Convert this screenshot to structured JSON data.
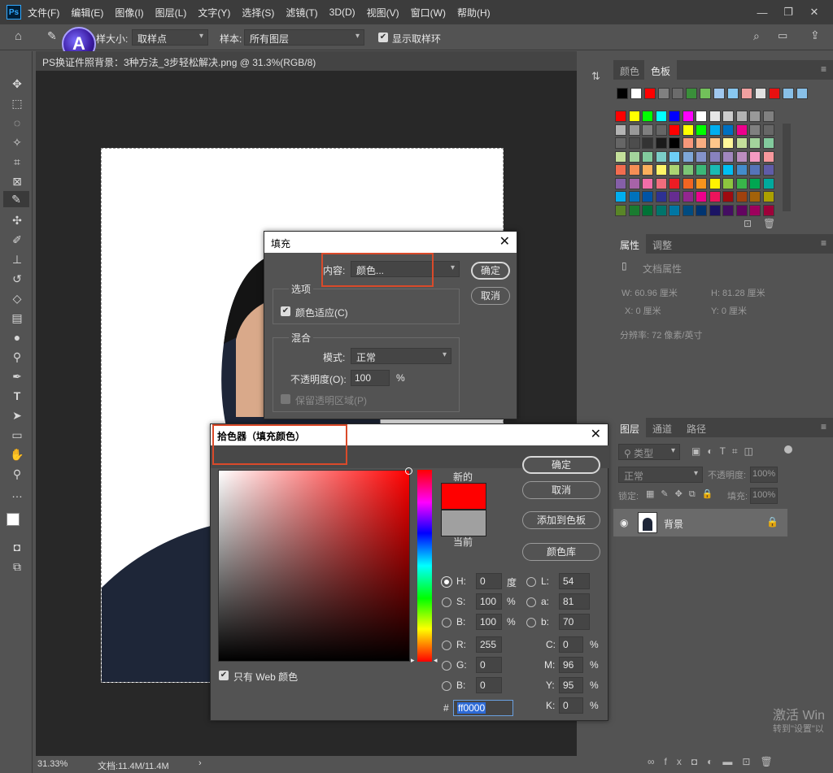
{
  "app": {
    "logo": "Ps"
  },
  "menu": [
    "文件(F)",
    "编辑(E)",
    "图像(I)",
    "图层(L)",
    "文字(Y)",
    "选择(S)",
    "滤镜(T)",
    "3D(D)",
    "视图(V)",
    "窗口(W)",
    "帮助(H)"
  ],
  "options": {
    "sample_size_label": "样大小:",
    "sample_size_value": "取样点",
    "sample_label": "样本:",
    "sample_value": "所有图层",
    "show_ring": "显示取样环"
  },
  "document": {
    "tab_title": "PS换证件照背景：3种方法_3步轻松解决.png @ 31.3%(RGB/8)",
    "tab_close": "×",
    "zoom": "31.33%",
    "doc_size": "文档:11.4M/11.4M"
  },
  "swatches_panel": {
    "tabs": [
      "颜色",
      "色板"
    ],
    "recent": [
      "#000000",
      "#ffffff",
      "#ff0000",
      "#808080",
      "#6b6b6b",
      "#3a8f3a",
      "#72c05a",
      "#a0c8ee",
      "#88c8f0",
      "#f0a0a0",
      "#e0e0e0",
      "#e81010",
      "#88c0e8",
      "#88c0e8"
    ],
    "grid": [
      [
        "#ff0000",
        "#ffff00",
        "#00ff00",
        "#00ffff",
        "#0000ff",
        "#ff00ff",
        "#ffffff",
        "#e6e6e6",
        "#cccccc",
        "#b3b3b3",
        "#999999",
        "#808080"
      ],
      [
        "#b3b3b3",
        "#999999",
        "#808080",
        "#666666",
        "#ff0000",
        "#ffff00",
        "#00ff00",
        "#00aeef",
        "#0070c0",
        "#ec008c",
        "#808080",
        "#666666"
      ],
      [
        "#666666",
        "#4d4d4d",
        "#333333",
        "#1a1a1a",
        "#000000",
        "#f7977a",
        "#f9ad81",
        "#fdc68a",
        "#fff79a",
        "#c4df9b",
        "#a3d39c",
        "#82ca9d"
      ],
      [
        "#c4df9b",
        "#a3d39c",
        "#82ca9d",
        "#7bcdc8",
        "#6ecff6",
        "#7ea7d8",
        "#8493ca",
        "#8882be",
        "#a187be",
        "#bc8dbf",
        "#f49ac2",
        "#f6989d"
      ],
      [
        "#f26c4f",
        "#f68e55",
        "#fbaf5c",
        "#fff467",
        "#acd372",
        "#7cc576",
        "#3bb878",
        "#1abbb4",
        "#00bff3",
        "#438ccb",
        "#5574b9",
        "#605ca8"
      ],
      [
        "#855fa8",
        "#a763a8",
        "#f06ea9",
        "#f26d7d",
        "#ed1c24",
        "#f26522",
        "#f7941d",
        "#fff200",
        "#8dc63f",
        "#39b54a",
        "#00a651",
        "#00a99d"
      ],
      [
        "#00aeef",
        "#0072bc",
        "#0054a6",
        "#2e3192",
        "#662d91",
        "#92278f",
        "#ec008c",
        "#ed145b",
        "#9e0b0f",
        "#a0410d",
        "#a36209",
        "#aba000"
      ],
      [
        "#598527",
        "#1a7b30",
        "#007236",
        "#00746b",
        "#0076a3",
        "#004b80",
        "#003471",
        "#1b1464",
        "#440e62",
        "#630460",
        "#9e005d",
        "#9e0039"
      ]
    ]
  },
  "properties_panel": {
    "tabs": [
      "属性",
      "调整"
    ],
    "doc_props": "文档属性",
    "w": "W: 60.96 厘米",
    "h": "H: 81.28 厘米",
    "x": "X: 0 厘米",
    "y": "Y: 0 厘米",
    "resolution": "分辨率: 72 像素/英寸"
  },
  "layers_panel": {
    "tabs": [
      "图层",
      "通道",
      "路径"
    ],
    "filter_kind": "类型",
    "blend_mode": "正常",
    "opacity_label": "不透明度:",
    "opacity_value": "100%",
    "lock_label": "锁定:",
    "fill_label": "填充:",
    "fill_value": "100%",
    "layers": [
      {
        "name": "背景"
      }
    ]
  },
  "fill_dialog": {
    "title": "填充",
    "content_label": "内容:",
    "content_value": "颜色...",
    "ok": "确定",
    "cancel": "取消",
    "options_title": "选项",
    "color_adapt": "颜色适应(C)",
    "blend_title": "混合",
    "mode_label": "模式:",
    "mode_value": "正常",
    "opacity_label": "不透明度(O):",
    "opacity_value": "100",
    "opacity_unit": "%",
    "preserve": "保留透明区域(P)"
  },
  "picker_dialog": {
    "title": "拾色器（填充颜色）",
    "new_label": "新的",
    "current_label": "当前",
    "ok": "确定",
    "cancel": "取消",
    "add_swatch": "添加到色板",
    "color_lib": "颜色库",
    "web_only": "只有 Web 颜色",
    "new_color": "#ff0000",
    "current_color": "#a0a0a0",
    "fields": {
      "H": {
        "label": "H:",
        "value": "0",
        "unit": "度"
      },
      "S": {
        "label": "S:",
        "value": "100",
        "unit": "%"
      },
      "Bv": {
        "label": "B:",
        "value": "100",
        "unit": "%"
      },
      "R": {
        "label": "R:",
        "value": "255"
      },
      "G": {
        "label": "G:",
        "value": "0"
      },
      "B": {
        "label": "B:",
        "value": "0"
      },
      "L": {
        "label": "L:",
        "value": "54"
      },
      "a": {
        "label": "a:",
        "value": "81"
      },
      "b": {
        "label": "b:",
        "value": "70"
      },
      "C": {
        "label": "C:",
        "value": "0",
        "unit": "%"
      },
      "M": {
        "label": "M:",
        "value": "96",
        "unit": "%"
      },
      "Y": {
        "label": "Y:",
        "value": "95",
        "unit": "%"
      },
      "K": {
        "label": "K:",
        "value": "0",
        "unit": "%"
      }
    },
    "hex_label": "#",
    "hex_value": "ff0000"
  },
  "watermark": {
    "line1": "激活 Win",
    "line2": "转到\"设置\"以"
  }
}
